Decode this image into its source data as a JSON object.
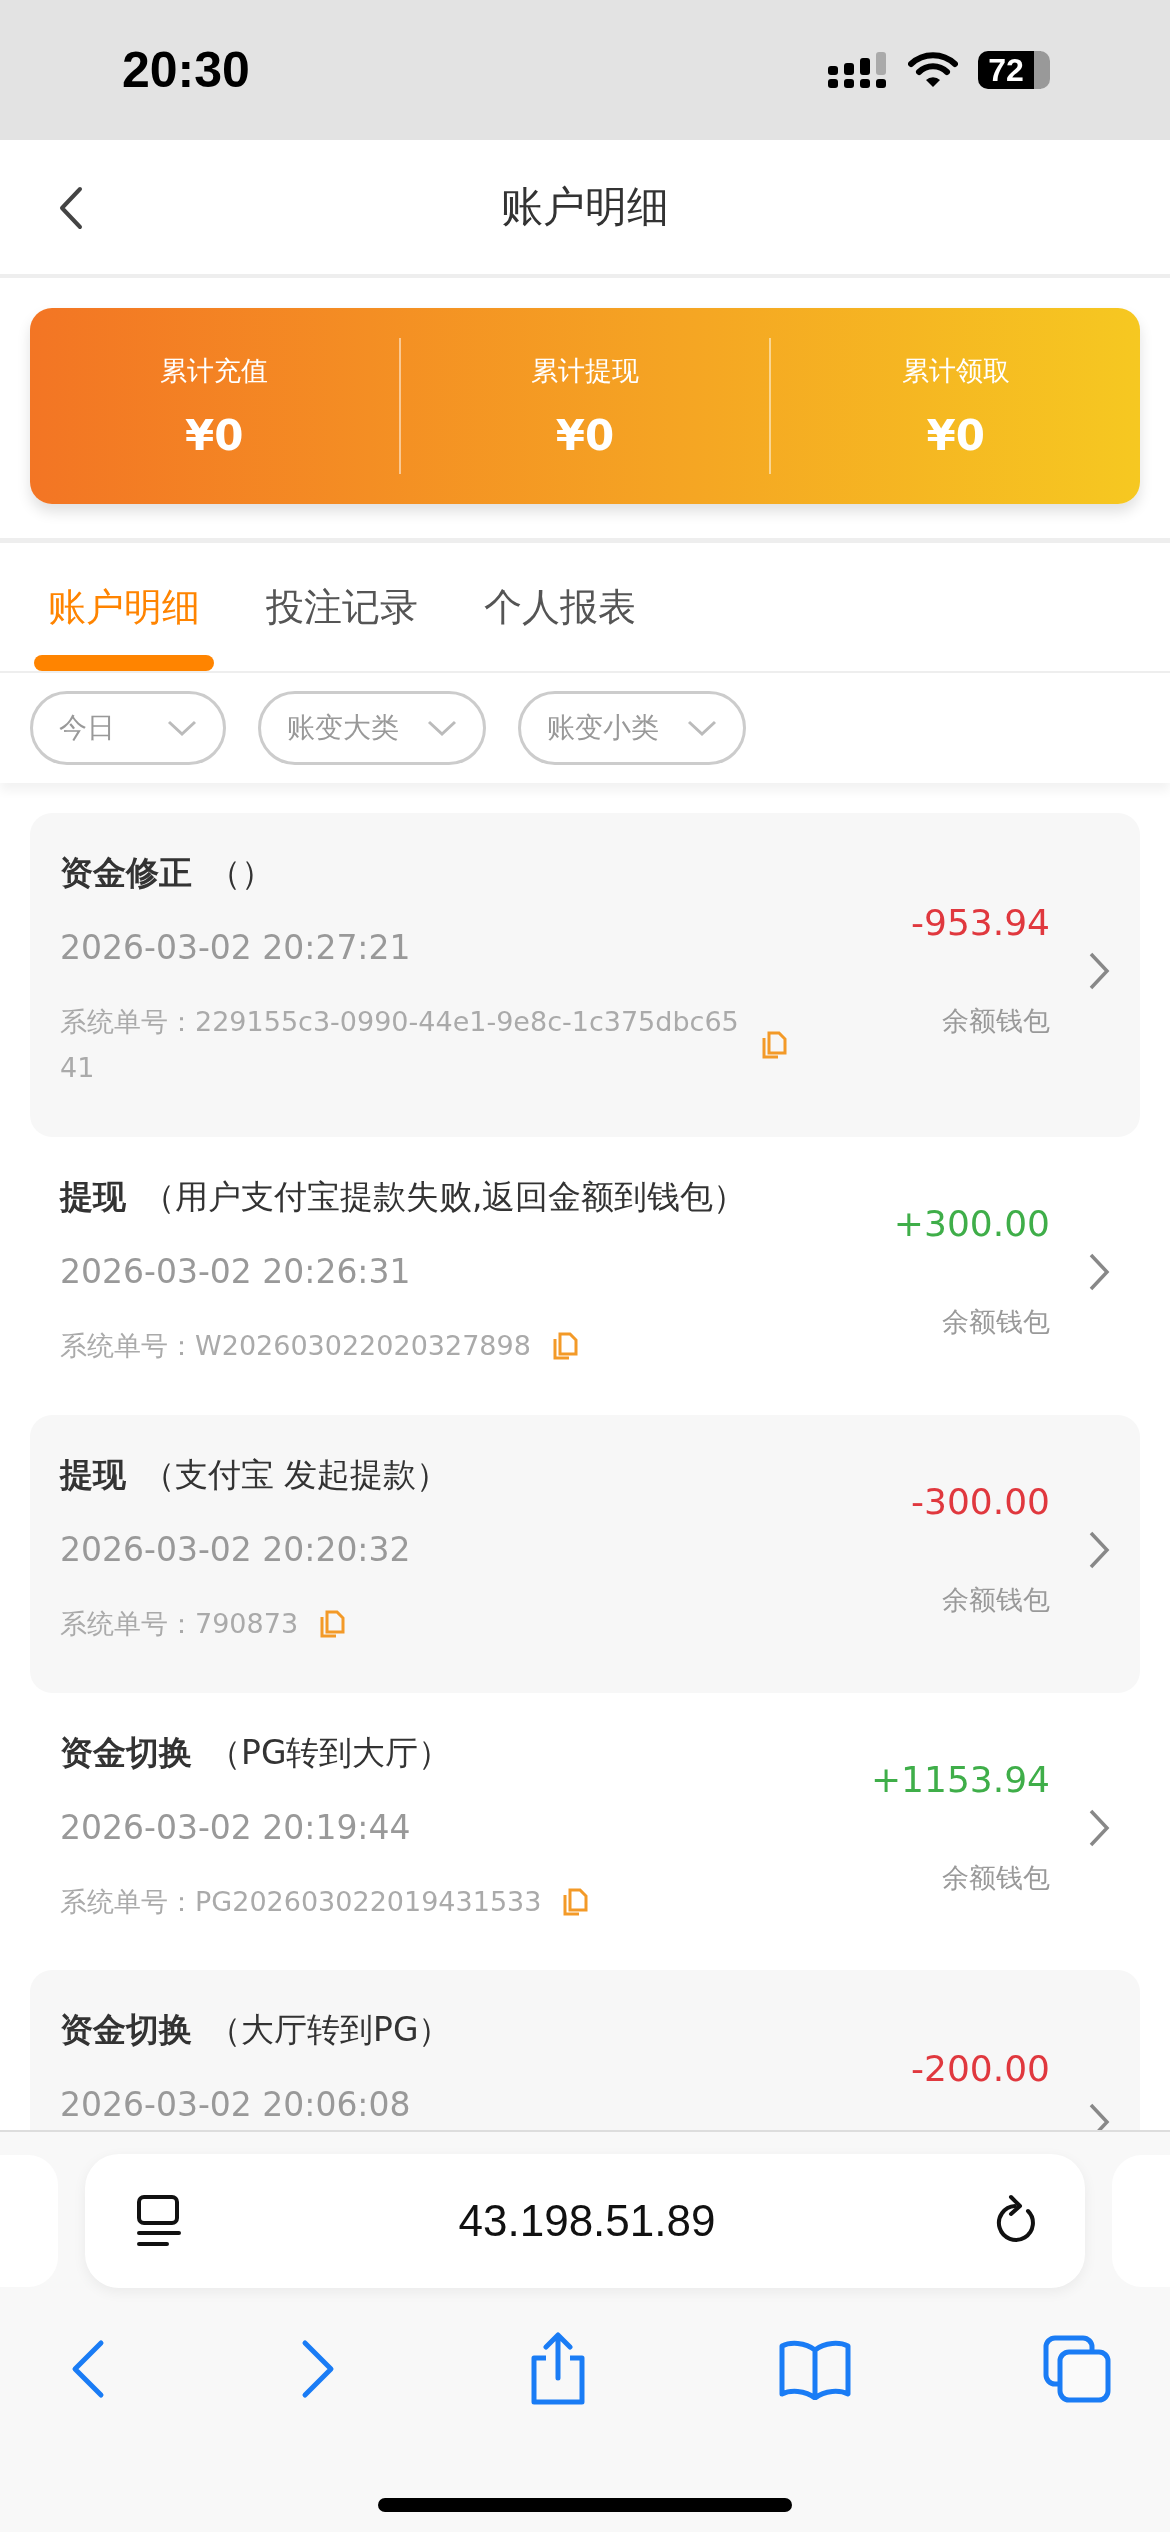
{
  "status_bar": {
    "time": "20:30",
    "battery": "72"
  },
  "header": {
    "title": "账户明细"
  },
  "summary": [
    {
      "label": "累计充值",
      "value": "¥0"
    },
    {
      "label": "累计提现",
      "value": "¥0"
    },
    {
      "label": "累计领取",
      "value": "¥0"
    }
  ],
  "tabs": [
    {
      "label": "账户明细",
      "selected": true
    },
    {
      "label": "投注记录",
      "selected": false
    },
    {
      "label": "个人报表",
      "selected": false
    }
  ],
  "filters": [
    {
      "label": "今日"
    },
    {
      "label": "账变大类"
    },
    {
      "label": "账变小类"
    }
  ],
  "records": [
    {
      "type": "资金修正",
      "note": "（）",
      "time": "2026-03-02 20:27:21",
      "order_label": "系统单号：",
      "order_no": "229155c3-0990-44e1-9e8c-1c375dbc6541",
      "amount": "-953.94",
      "kind": "debit",
      "wallet": "余额钱包"
    },
    {
      "type": "提现",
      "note": "（用户支付宝提款失败,返回金额到钱包）",
      "time": "2026-03-02 20:26:31",
      "order_label": "系统单号：",
      "order_no": "W202603022020327898",
      "amount": "+300.00",
      "kind": "credit",
      "wallet": "余额钱包"
    },
    {
      "type": "提现",
      "note": "（支付宝 发起提款）",
      "time": "2026-03-02 20:20:32",
      "order_label": "系统单号：",
      "order_no": "790873",
      "amount": "-300.00",
      "kind": "debit",
      "wallet": "余额钱包"
    },
    {
      "type": "资金切换",
      "note": "（PG转到大厅）",
      "time": "2026-03-02 20:19:44",
      "order_label": "系统单号：",
      "order_no": "PG202603022019431533",
      "amount": "+1153.94",
      "kind": "credit",
      "wallet": "余额钱包"
    },
    {
      "type": "资金切换",
      "note": "（大厅转到PG）",
      "time": "2026-03-02 20:06:08",
      "amount": "-200.00",
      "kind": "debit"
    }
  ],
  "browser": {
    "url": "43.198.51.89"
  }
}
